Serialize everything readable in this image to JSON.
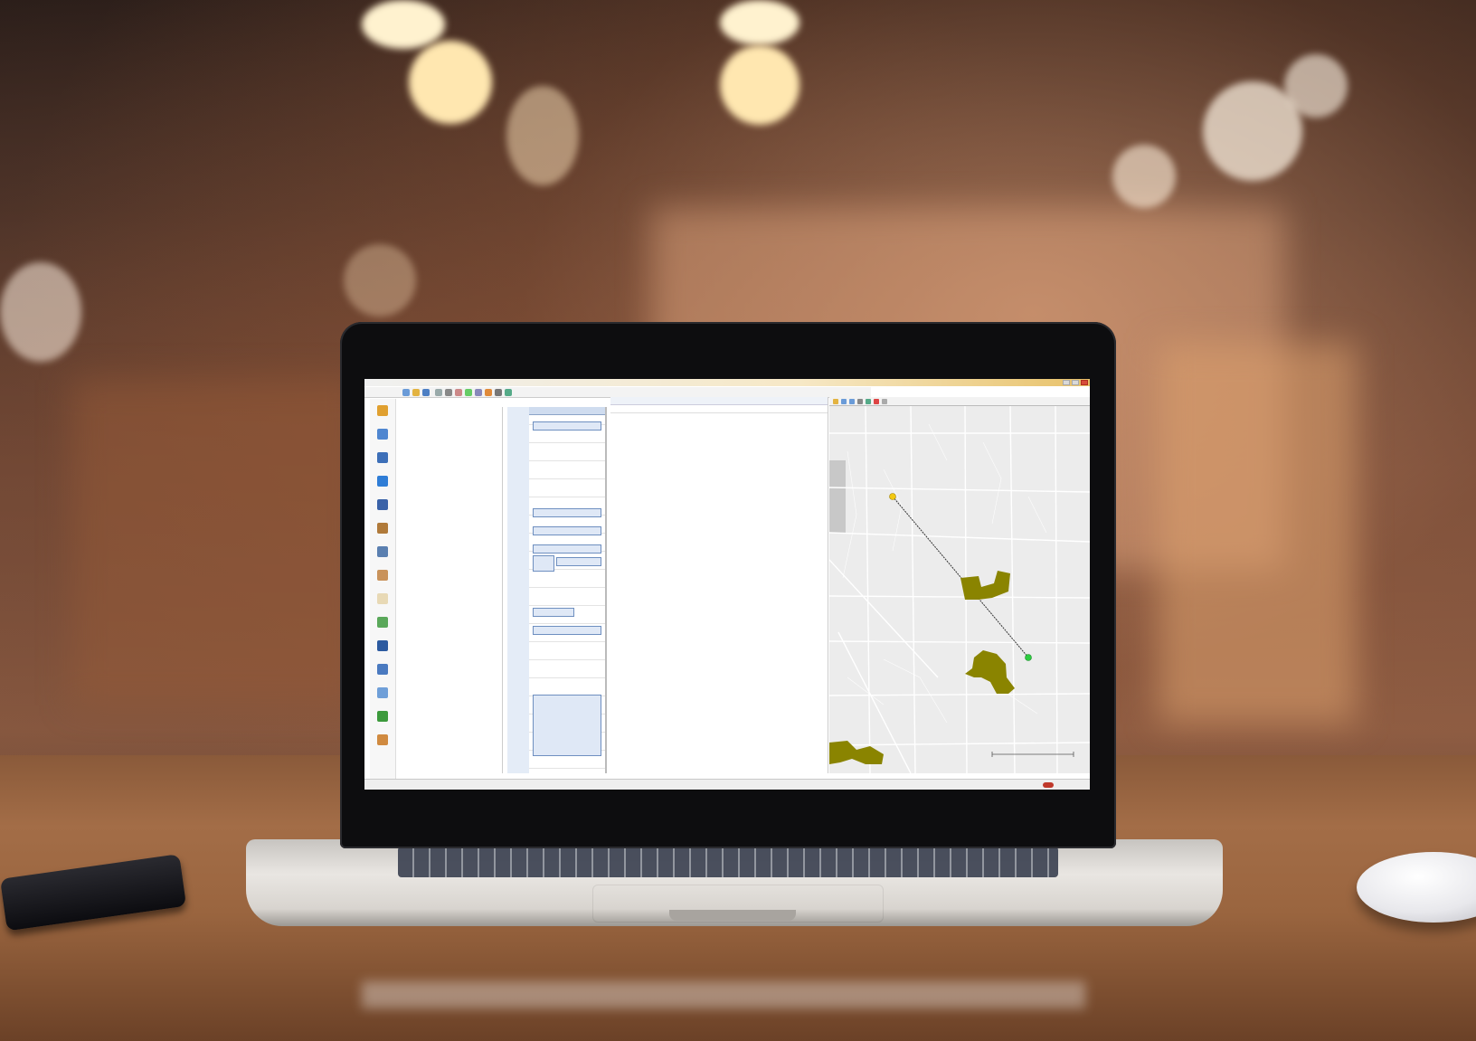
{
  "window": {
    "title": "",
    "controls": [
      "minimize-icon",
      "maximize-icon",
      "close-icon"
    ]
  },
  "toolbar": {
    "items": [
      "new-icon",
      "open-icon",
      "save-icon",
      "search-icon",
      "print-icon",
      "filter-icon",
      "refresh-icon",
      "zoom-icon",
      "route-icon",
      "settings-icon",
      "help-icon"
    ],
    "label_left": "",
    "label_right": ""
  },
  "sidebar": {
    "items": [
      {
        "icon": "dispatch-icon",
        "label": ""
      },
      {
        "icon": "chart-icon",
        "label": ""
      },
      {
        "icon": "truck-icon",
        "label": ""
      },
      {
        "icon": "arrow-icon",
        "label": ""
      },
      {
        "icon": "users-icon",
        "label": ""
      },
      {
        "icon": "box-icon",
        "label": ""
      },
      {
        "icon": "grid-icon",
        "label": ""
      },
      {
        "icon": "person-icon",
        "label": ""
      },
      {
        "icon": "document-icon",
        "label": ""
      },
      {
        "icon": "clipboard-icon",
        "label": ""
      },
      {
        "icon": "database-icon",
        "label": ""
      },
      {
        "icon": "tools-icon",
        "label": ""
      },
      {
        "icon": "link-icon",
        "label": ""
      },
      {
        "icon": "dollar-icon",
        "label": ""
      },
      {
        "icon": "calendar-icon",
        "label": ""
      }
    ]
  },
  "tree": {
    "header": "",
    "rows": [
      "",
      "",
      "",
      "",
      "",
      "",
      ""
    ]
  },
  "schedule": {
    "header": "",
    "times": [
      "",
      "",
      "",
      "",
      "",
      "",
      "",
      "",
      "",
      "",
      "",
      "",
      "",
      "",
      "",
      "",
      "",
      "",
      ""
    ],
    "appointments": [
      "",
      "",
      "",
      "",
      "",
      "",
      "",
      "",
      ""
    ]
  },
  "explorer": {
    "header": "",
    "search_placeholder": "",
    "rows": [
      "",
      "",
      "",
      ""
    ]
  },
  "map": {
    "route_color": "#333333",
    "area_color": "#8a8400",
    "marker_start_color": "#f2c811",
    "marker_end_color": "#2ecc40"
  },
  "status": {
    "center": "",
    "right": ""
  },
  "colors": {
    "accent": "#e8c26a",
    "schedule_blue": "#6e8fc0",
    "brand_red": "#c0392b"
  }
}
